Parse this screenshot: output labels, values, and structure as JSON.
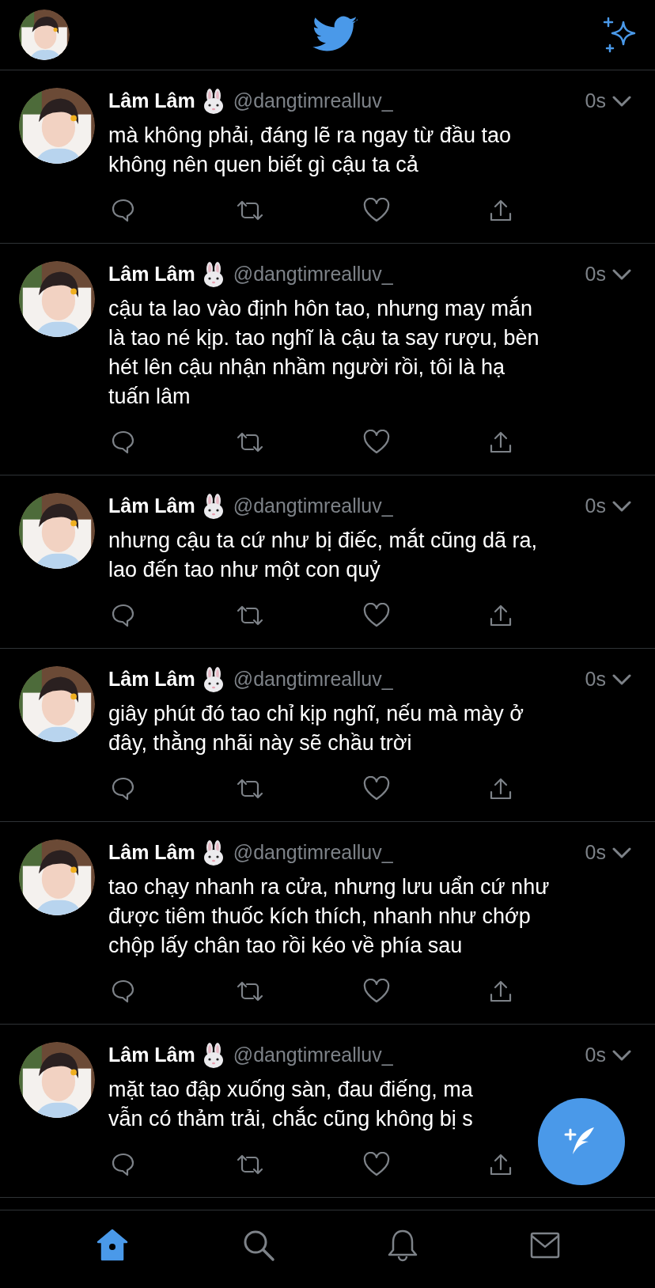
{
  "tweets": [
    {
      "name": "Lâm Lâm",
      "handle": "@dangtimrealluv_",
      "time": "0s",
      "lines": [
        "mà không phải, đáng lẽ ra ngay từ đầu tao",
        "không nên quen biết gì cậu ta cả"
      ]
    },
    {
      "name": "Lâm Lâm",
      "handle": "@dangtimrealluv_",
      "time": "0s",
      "lines": [
        "cậu ta lao vào định hôn tao, nhưng may mắn",
        "là tao né kịp. tao nghĩ là cậu ta say rượu, bèn",
        "hét lên cậu nhận nhầm người rồi, tôi là hạ",
        "tuấn lâm"
      ]
    },
    {
      "name": "Lâm Lâm",
      "handle": "@dangtimrealluv_",
      "time": "0s",
      "lines": [
        "nhưng cậu ta cứ như bị điếc, mắt cũng dã ra,",
        "lao đến tao như một con quỷ"
      ]
    },
    {
      "name": "Lâm Lâm",
      "handle": "@dangtimrealluv_",
      "time": "0s",
      "lines": [
        "giây phút đó tao chỉ kịp nghĩ, nếu mà mày ở",
        "đây, thằng nhãi này sẽ chầu trời"
      ]
    },
    {
      "name": "Lâm Lâm",
      "handle": "@dangtimrealluv_",
      "time": "0s",
      "lines": [
        "tao chạy nhanh ra cửa, nhưng lưu uẩn cứ như",
        "được tiêm thuốc kích thích, nhanh như chớp",
        "chộp lấy chân tao rồi kéo về phía sau"
      ]
    },
    {
      "name": "Lâm Lâm",
      "handle": "@dangtimrealluv_",
      "time": "0s",
      "lines": [
        "mặt tao đập xuống sàn, đau điếng, ma",
        "vẫn có thảm trải, chắc cũng không bị s"
      ]
    }
  ],
  "nav": [
    {
      "kind": "home",
      "selected": true
    },
    {
      "kind": "search",
      "selected": false
    },
    {
      "kind": "notifications",
      "selected": false
    },
    {
      "kind": "messages",
      "selected": false
    }
  ]
}
